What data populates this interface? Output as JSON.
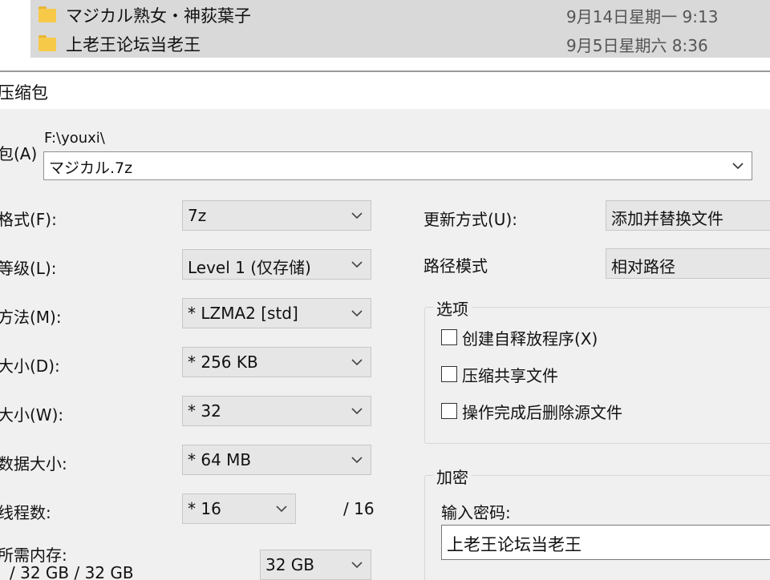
{
  "explorer": {
    "files": [
      {
        "name": "マジカル熟女・神荻葉子",
        "date": "9月14日星期一 9:13"
      },
      {
        "name": "上老王论坛当老王",
        "date": "9月5日星期六 8:36"
      }
    ]
  },
  "dialog": {
    "title": "压缩包",
    "archive_label": "包(A)",
    "archive_path": "F:\\youxi\\",
    "archive_name": "マジカル.7z",
    "format_label": "格式(F):",
    "format_value": "7z",
    "level_label": "等级(L):",
    "level_value": "Level 1 (仅存储)",
    "method_label": "方法(M):",
    "method_value": "*  LZMA2 [std]",
    "dict_label": "大小(D):",
    "dict_value": "*  256 KB",
    "word_label": "大小(W):",
    "word_value": "*  32",
    "block_label": "数据大小:",
    "block_value": "*  64 MB",
    "threads_label": "线程数:",
    "threads_value": "*  16",
    "threads_max": "/ 16",
    "memory_label": "所需内存:",
    "memory_info": "/ 32 GB / 32 GB",
    "memory_value": "32 GB",
    "update_label": "更新方式(U):",
    "update_value": "添加并替换文件",
    "pathmode_label": "路径模式",
    "pathmode_value": "相对路径",
    "options": {
      "title": "选项",
      "sfx": "创建自释放程序(X)",
      "shared": "压缩共享文件",
      "delete": "操作完成后删除源文件"
    },
    "encryption": {
      "title": "加密",
      "password_label": "输入密码:",
      "password_value": "上老王论坛当老王"
    }
  },
  "colors": {
    "row_selected": "#d9d9d9",
    "folder": "#f7c948",
    "dialog_bg": "#f0f0f0"
  },
  "icons": [
    "folder-icon",
    "chevron-down-icon",
    "checkbox-icon"
  ]
}
